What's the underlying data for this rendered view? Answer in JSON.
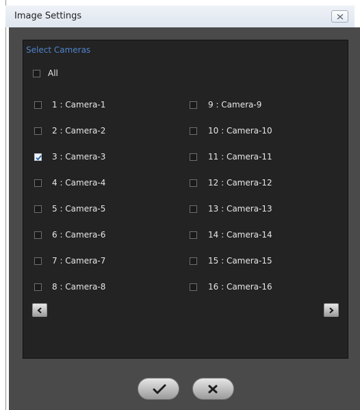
{
  "window": {
    "title": "Image Settings",
    "close_icon": "close-icon"
  },
  "section": {
    "title": "Select Cameras"
  },
  "all_option": {
    "label": "All",
    "checked": false
  },
  "cameras_left": [
    {
      "label": "1 : Camera-1",
      "checked": false
    },
    {
      "label": "2 : Camera-2",
      "checked": false
    },
    {
      "label": "3 : Camera-3",
      "checked": true
    },
    {
      "label": "4 : Camera-4",
      "checked": false
    },
    {
      "label": "5 : Camera-5",
      "checked": false
    },
    {
      "label": "6 : Camera-6",
      "checked": false
    },
    {
      "label": "7 : Camera-7",
      "checked": false
    },
    {
      "label": "8 : Camera-8",
      "checked": false
    }
  ],
  "cameras_right": [
    {
      "label": "9 : Camera-9",
      "checked": false
    },
    {
      "label": "10 : Camera-10",
      "checked": false
    },
    {
      "label": "11 : Camera-11",
      "checked": false
    },
    {
      "label": "12 : Camera-12",
      "checked": false
    },
    {
      "label": "13 : Camera-13",
      "checked": false
    },
    {
      "label": "14 : Camera-14",
      "checked": false
    },
    {
      "label": "15 : Camera-15",
      "checked": false
    },
    {
      "label": "16 : Camera-16",
      "checked": false
    }
  ],
  "pager": {
    "prev_icon": "chevron-left-icon",
    "next_icon": "chevron-right-icon"
  },
  "actions": {
    "confirm_icon": "check-icon",
    "cancel_icon": "close-icon"
  },
  "colors": {
    "section_title": "#4f84cb",
    "panel_background": "#232323",
    "dialog_background": "#4a4a4a",
    "text": "#e7e7e7"
  }
}
